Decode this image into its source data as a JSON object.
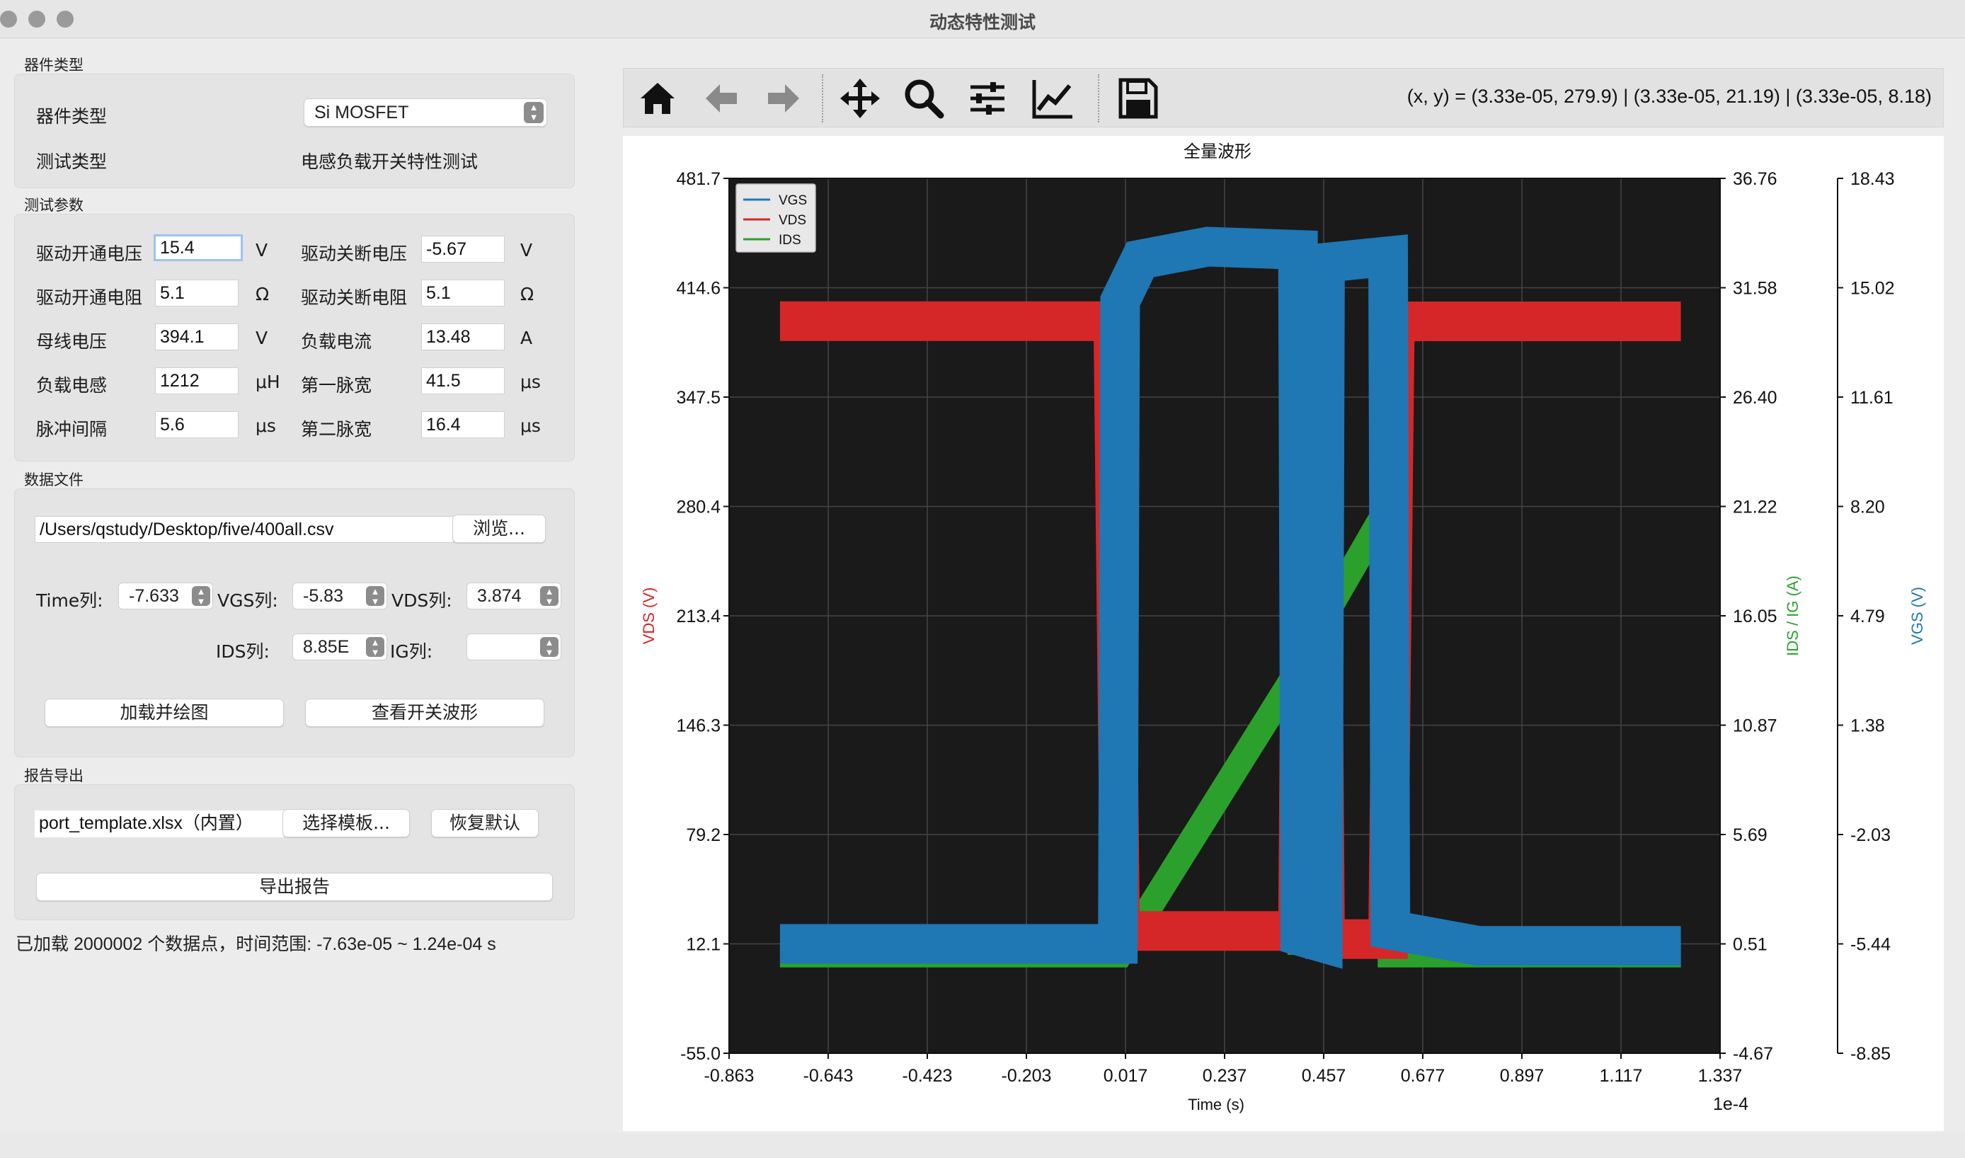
{
  "window": {
    "title": "动态特性测试"
  },
  "device_section": {
    "title": "器件类型",
    "device_type_label": "器件类型",
    "device_type_value": "Si MOSFET",
    "test_type_label": "测试类型",
    "test_type_value": "电感负载开关特性测试"
  },
  "params_section": {
    "title": "测试参数",
    "rows": [
      {
        "l1": "驱动开通电压",
        "v1": "15.4",
        "u1": "V",
        "l2": "驱动关断电压",
        "v2": "-5.67",
        "u2": "V"
      },
      {
        "l1": "驱动开通电阻",
        "v1": "5.1",
        "u1": "Ω",
        "l2": "驱动关断电阻",
        "v2": "5.1",
        "u2": "Ω"
      },
      {
        "l1": "母线电压",
        "v1": "394.1",
        "u1": "V",
        "l2": "负载电流",
        "v2": "13.48",
        "u2": "A"
      },
      {
        "l1": "负载电感",
        "v1": "1212",
        "u1": "μH",
        "l2": "第一脉宽",
        "v2": "41.5",
        "u2": "μs"
      },
      {
        "l1": "脉冲间隔",
        "v1": "5.6",
        "u1": "μs",
        "l2": "第二脉宽",
        "v2": "16.4",
        "u2": "μs"
      }
    ]
  },
  "data_section": {
    "title": "数据文件",
    "file_path": "/Users/qstudy/Desktop/five/400all.csv",
    "browse_label": "浏览...",
    "time_col_label": "Time列:",
    "time_col_value": "-7.633",
    "vgs_col_label": "VGS列:",
    "vgs_col_value": "-5.83",
    "vds_col_label": "VDS列:",
    "vds_col_value": "3.874",
    "ids_col_label": "IDS列:",
    "ids_col_value": "8.85E",
    "ig_col_label": "IG列:",
    "ig_col_value": "",
    "load_button": "加载并绘图",
    "switch_wave_button": "查看开关波形"
  },
  "report_section": {
    "title": "报告导出",
    "template_value": "port_template.xlsx（内置）",
    "choose_template_button": "选择模板...",
    "restore_default_button": "恢复默认",
    "export_button": "导出报告"
  },
  "status_text": "已加载 2000002 个数据点，时间范围: -7.63e-05 ~ 1.24e-04 s",
  "toolbar": {
    "icons": [
      "home-icon",
      "back-arrow-icon",
      "forward-arrow-icon",
      "pan-move-icon",
      "zoom-icon",
      "subplots-config-icon",
      "axes-edit-icon",
      "save-icon"
    ],
    "coords_text": "(x, y) = (3.33e-05, 279.9) | (3.33e-05, 21.19) | (3.33e-05, 8.18)"
  },
  "chart_data": {
    "type": "line",
    "title": "全量波形",
    "xlabel": "Time (s)",
    "x_offset_label": "1e-4",
    "xlim": [
      -0.863,
      1.337
    ],
    "x_ticks": [
      "-0.863",
      "-0.643",
      "-0.423",
      "-0.203",
      "0.017",
      "0.237",
      "0.457",
      "0.677",
      "0.897",
      "1.117",
      "1.337"
    ],
    "y_left": {
      "label": "VDS (V)",
      "color": "#d62728",
      "ylim": [
        -55.0,
        481.7
      ],
      "ticks": [
        "481.7",
        "414.6",
        "347.5",
        "280.4",
        "213.4",
        "146.3",
        "79.2",
        "12.1",
        "-55.0"
      ]
    },
    "y_right1": {
      "label": "IDS / IG (A)",
      "color": "#2ca02c",
      "ylim": [
        -4.67,
        36.76
      ],
      "ticks": [
        "36.76",
        "31.58",
        "26.40",
        "21.22",
        "16.05",
        "10.87",
        "5.69",
        "0.51",
        "-4.67"
      ]
    },
    "y_right2": {
      "label": "VGS (V)",
      "color": "#1f77b4",
      "ylim": [
        -8.85,
        18.43
      ],
      "ticks": [
        "18.43",
        "15.02",
        "11.61",
        "8.20",
        "4.79",
        "1.38",
        "-2.03",
        "-5.44",
        "-8.85"
      ]
    },
    "grid": true,
    "legend_position": "top-left",
    "background": "#1a1a1a",
    "series": [
      {
        "name": "VGS",
        "color": "#1f77b4",
        "axis": "y_right2",
        "points": [
          [
            -0.75,
            -5.44
          ],
          [
            0.0,
            -5.44
          ],
          [
            0.005,
            14.6
          ],
          [
            0.05,
            15.9
          ],
          [
            0.2,
            16.3
          ],
          [
            0.4,
            16.2
          ],
          [
            0.405,
            -5.2
          ],
          [
            0.455,
            -5.4
          ],
          [
            0.46,
            15.8
          ],
          [
            0.6,
            16.0
          ],
          [
            0.605,
            -5.0
          ],
          [
            0.8,
            -5.5
          ],
          [
            1.25,
            -5.5
          ]
        ]
      },
      {
        "name": "VDS",
        "color": "#d62728",
        "axis": "y_left",
        "points": [
          [
            -0.75,
            394.1
          ],
          [
            -0.01,
            394.1
          ],
          [
            0.005,
            20.0
          ],
          [
            0.2,
            20.0
          ],
          [
            0.4,
            20.0
          ],
          [
            0.41,
            394.0
          ],
          [
            0.45,
            394.0
          ],
          [
            0.46,
            15.0
          ],
          [
            0.6,
            15.0
          ],
          [
            0.615,
            394.0
          ],
          [
            1.25,
            394.0
          ]
        ]
      },
      {
        "name": "IDS",
        "color": "#2ca02c",
        "axis": "y_right1",
        "points": [
          [
            -0.75,
            0.0
          ],
          [
            0.005,
            0.0
          ],
          [
            0.4,
            13.48
          ],
          [
            0.405,
            0.0
          ],
          [
            0.46,
            16.05
          ],
          [
            0.6,
            21.22
          ],
          [
            0.605,
            0.0
          ],
          [
            1.25,
            0.0
          ]
        ]
      }
    ]
  }
}
